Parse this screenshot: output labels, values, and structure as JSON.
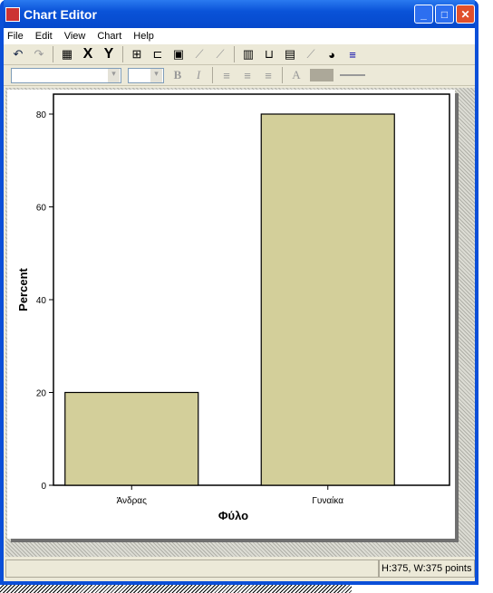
{
  "window": {
    "title": "Chart Editor",
    "buttons": [
      "minimize",
      "maximize",
      "close"
    ]
  },
  "menu": [
    "File",
    "Edit",
    "View",
    "Chart",
    "Help"
  ],
  "toolbar": {
    "undo": "undo-icon",
    "redo": "redo-icon",
    "properties": "properties-icon",
    "x_label": "X",
    "y_label": "Y",
    "bold": "B",
    "italic": "I",
    "font_color": "A"
  },
  "status": {
    "text": "",
    "size": "H:375, W:375 points"
  },
  "chart_data": {
    "type": "bar",
    "categories": [
      "Άνδρας",
      "Γυναίκα"
    ],
    "values": [
      20,
      80
    ],
    "xlabel": "Φύλο",
    "ylabel": "Percent",
    "ylim": [
      0,
      84
    ],
    "yticks": [
      0,
      20,
      40,
      60,
      80
    ],
    "bar_color": "#d3cf9a",
    "grid": false
  }
}
